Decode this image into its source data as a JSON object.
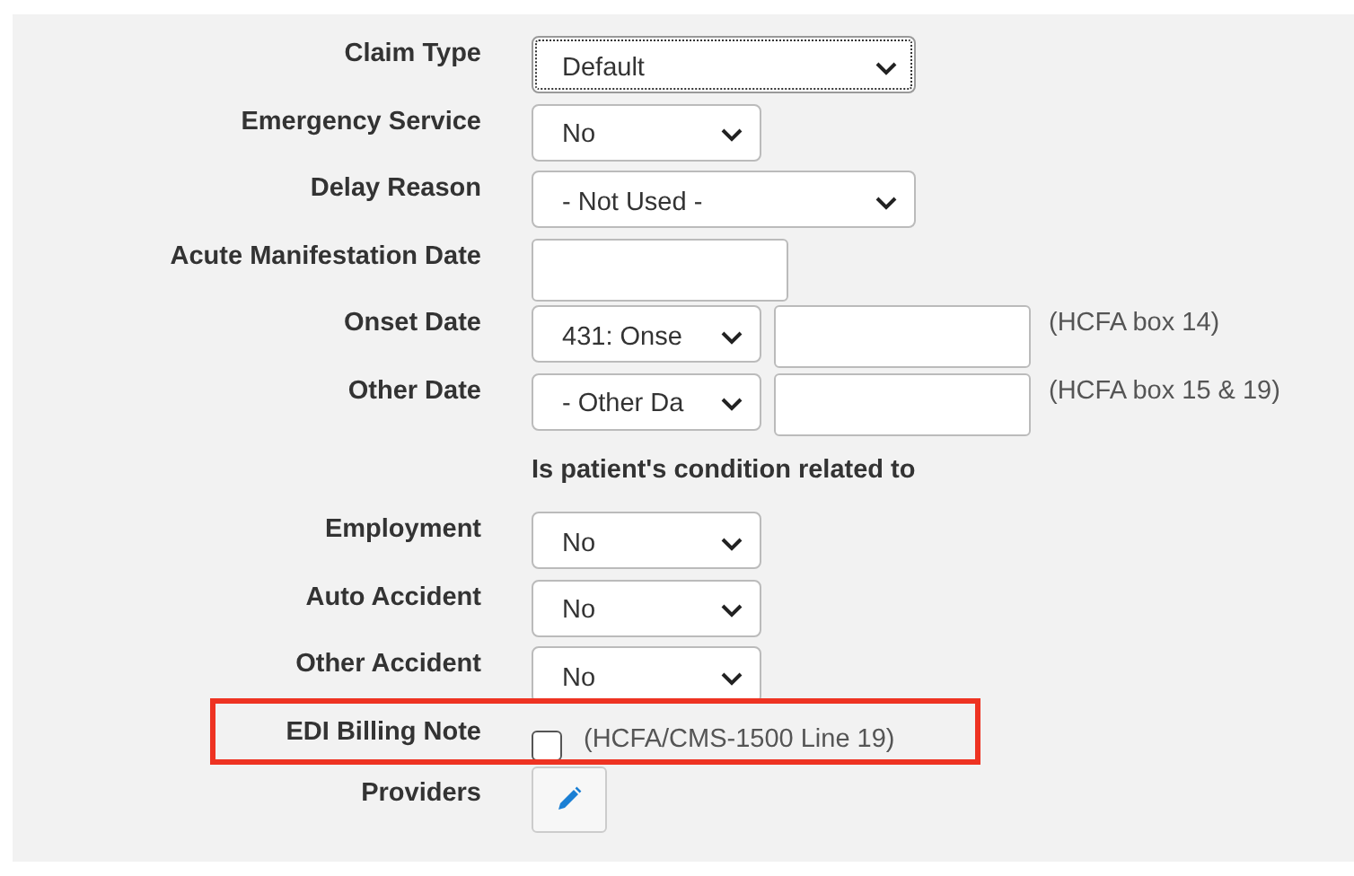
{
  "rows": [
    {
      "kind": "wide_select",
      "label": "Claim Type",
      "value": "Default",
      "focused": true
    },
    {
      "kind": "select",
      "label": "Emergency Service",
      "value": "No",
      "focused": false
    },
    {
      "kind": "wide_select",
      "label": "Delay Reason",
      "value": "- Not Used -",
      "focused": false
    },
    {
      "kind": "input",
      "label": "Acute Manifestation Date"
    },
    {
      "kind": "select_input",
      "label": "Onset Date",
      "value": "431: Onse",
      "note": "(HCFA box 14)"
    },
    {
      "kind": "select_input",
      "label": "Other Date",
      "value": "- Other Da",
      "note": "(HCFA box 15 & 19)"
    },
    {
      "kind": "heading",
      "text": "Is patient's condition related to"
    },
    {
      "kind": "select",
      "label": "Employment",
      "value": "No",
      "focused": false
    },
    {
      "kind": "select",
      "label": "Auto Accident",
      "value": "No",
      "focused": false
    },
    {
      "kind": "select",
      "label": "Other Accident",
      "value": "No",
      "focused": false
    },
    {
      "kind": "checkbox",
      "label": "EDI Billing Note",
      "checked": false,
      "note": "(HCFA/CMS-1500 Line 19)",
      "highlighted": true
    },
    {
      "kind": "edit",
      "label": "Providers"
    }
  ]
}
